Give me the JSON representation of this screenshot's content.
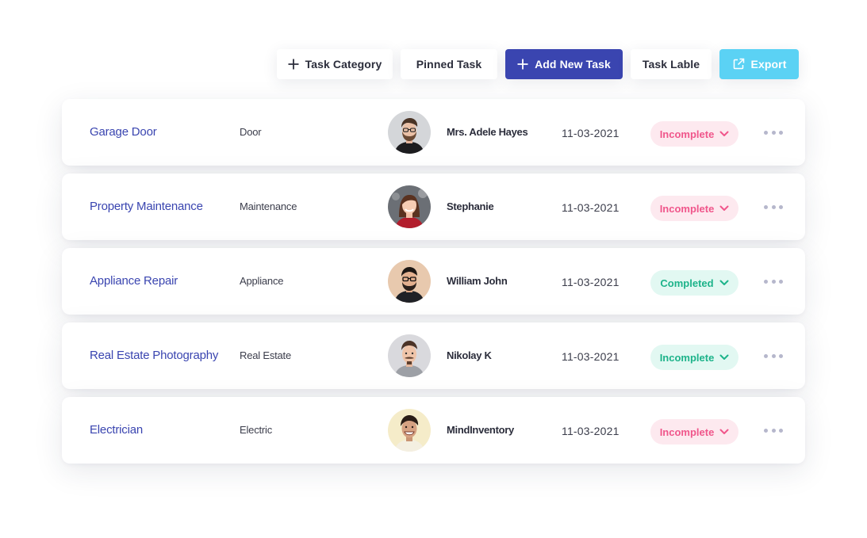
{
  "colors": {
    "primary": "#3a45b0",
    "export": "#5bd2f4",
    "title": "#3a45b0",
    "incomplete_bg": "#fde9ef",
    "incomplete_text": "#f0568b",
    "completed_bg": "#e2f8f2",
    "completed_text": "#1db38a"
  },
  "toolbar": {
    "task_category": {
      "label": "Task Category",
      "icon": "plus-icon"
    },
    "pinned_task": {
      "label": "Pinned Task"
    },
    "add_new_task": {
      "label": "Add New Task",
      "icon": "plus-icon"
    },
    "task_lable": {
      "label": "Task Lable"
    },
    "export": {
      "label": "Export",
      "icon": "export-icon"
    }
  },
  "tasks": [
    {
      "title": "Garage Door",
      "category": "Door",
      "assignee": "Mrs. Adele Hayes",
      "avatar": "avatar-man-glasses-beard",
      "date": "11-03-2021",
      "status": "Incomplete",
      "status_style": "incomplete"
    },
    {
      "title": "Property Maintenance",
      "category": "Maintenance",
      "assignee": "Stephanie",
      "avatar": "avatar-woman-smiling",
      "date": "11-03-2021",
      "status": "Incomplete",
      "status_style": "incomplete"
    },
    {
      "title": "Appliance Repair",
      "category": "Appliance",
      "assignee": "William John",
      "avatar": "avatar-man-glasses",
      "date": "11-03-2021",
      "status": "Completed",
      "status_style": "completed"
    },
    {
      "title": "Real Estate Photography",
      "category": "Real Estate",
      "assignee": "Nikolay K",
      "avatar": "avatar-man-mustache",
      "date": "11-03-2021",
      "status": "Incomplete",
      "status_style": "completed"
    },
    {
      "title": "Electrician",
      "category": "Electric",
      "assignee": "MindInventory",
      "avatar": "avatar-man-laughing",
      "date": "11-03-2021",
      "status": "Incomplete",
      "status_style": "incomplete"
    }
  ]
}
